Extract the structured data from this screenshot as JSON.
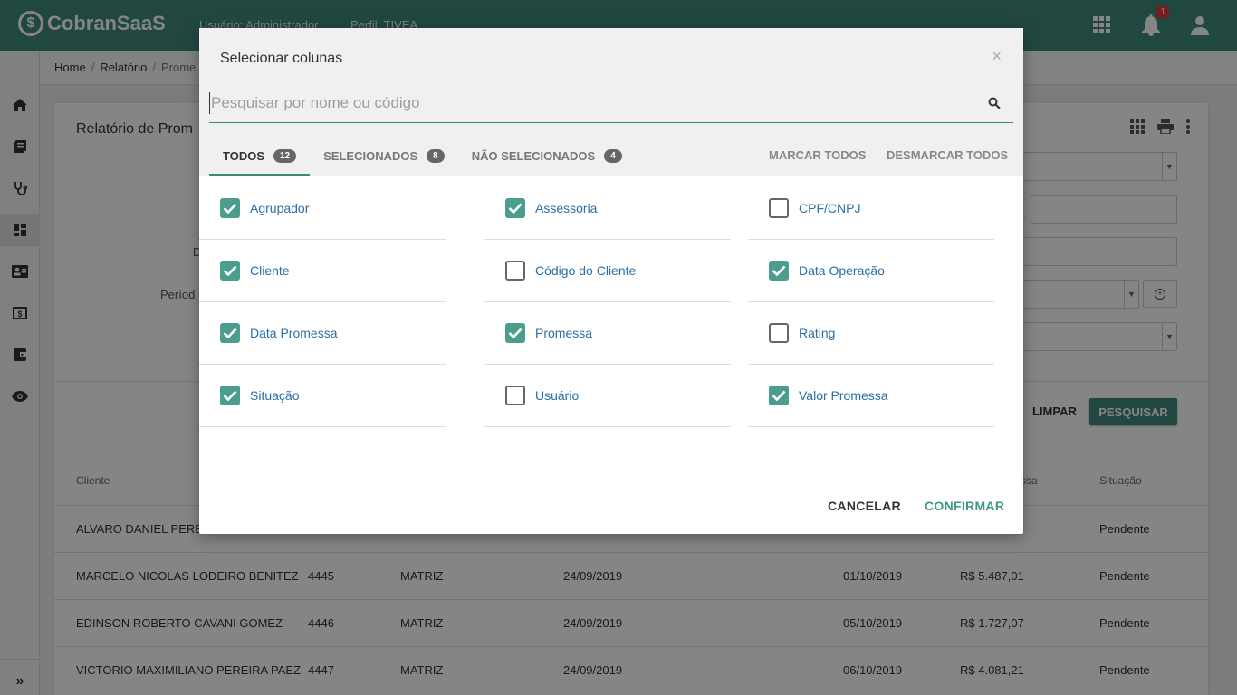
{
  "app": {
    "logo_text": "CobranSaaS",
    "user_label": "Usuário: Administrador",
    "profile_label": "Perfil: TIVEA",
    "notification_count": "1"
  },
  "breadcrumb": [
    "Home",
    "Relatório",
    "Prome"
  ],
  "page": {
    "title": "Relatório de Prom",
    "form_labels": {
      "d": "D",
      "periodo": "Períod"
    },
    "clear_button": "LIMPAR",
    "search_button": "PESQUISAR"
  },
  "table": {
    "headers": {
      "cliente": "Cliente",
      "valor": "ssa",
      "situacao": "Situação"
    },
    "rows": [
      {
        "cliente": "ALVARO DANIEL PEREIR",
        "codigo": "",
        "agrupador": "",
        "data_operacao": "",
        "data_promessa": "",
        "valor": "",
        "situacao": "Pendente"
      },
      {
        "cliente": "MARCELO NICOLAS LODEIRO BENITEZ",
        "codigo": "4445",
        "agrupador": "MATRIZ",
        "data_operacao": "24/09/2019",
        "data_promessa": "01/10/2019",
        "valor": "R$ 5.487,01",
        "situacao": "Pendente"
      },
      {
        "cliente": "EDINSON ROBERTO CAVANI GOMEZ",
        "codigo": "4446",
        "agrupador": "MATRIZ",
        "data_operacao": "24/09/2019",
        "data_promessa": "05/10/2019",
        "valor": "R$ 1.727,07",
        "situacao": "Pendente"
      },
      {
        "cliente": "VICTORIO MAXIMILIANO PEREIRA PAEZ",
        "codigo": "4447",
        "agrupador": "MATRIZ",
        "data_operacao": "24/09/2019",
        "data_promessa": "06/10/2019",
        "valor": "R$ 4.081,21",
        "situacao": "Pendente"
      }
    ]
  },
  "modal": {
    "title": "Selecionar colunas",
    "close": "×",
    "search_placeholder": "Pesquisar por nome ou código",
    "tabs": [
      {
        "label": "TODOS",
        "count": "12"
      },
      {
        "label": "SELECIONADOS",
        "count": "8"
      },
      {
        "label": "NÃO SELECIONADOS",
        "count": "4"
      }
    ],
    "mark_all": "MARCAR TODOS",
    "unmark_all": "DESMARCAR TODOS",
    "columns": [
      {
        "label": "Agrupador",
        "checked": true
      },
      {
        "label": "Assessoria",
        "checked": true
      },
      {
        "label": "CPF/CNPJ",
        "checked": false
      },
      {
        "label": "Cliente",
        "checked": true
      },
      {
        "label": "Código do Cliente",
        "checked": false
      },
      {
        "label": "Data Operação",
        "checked": true
      },
      {
        "label": "Data Promessa",
        "checked": true
      },
      {
        "label": "Promessa",
        "checked": true
      },
      {
        "label": "Rating",
        "checked": false
      },
      {
        "label": "Situação",
        "checked": true
      },
      {
        "label": "Usuário",
        "checked": false
      },
      {
        "label": "Valor Promessa",
        "checked": true
      }
    ],
    "cancel": "CANCELAR",
    "confirm": "CONFIRMAR"
  },
  "colors": {
    "primary": "#3e8b7d",
    "checkbox": "#4b9e8e",
    "link": "#2a6fa8"
  }
}
